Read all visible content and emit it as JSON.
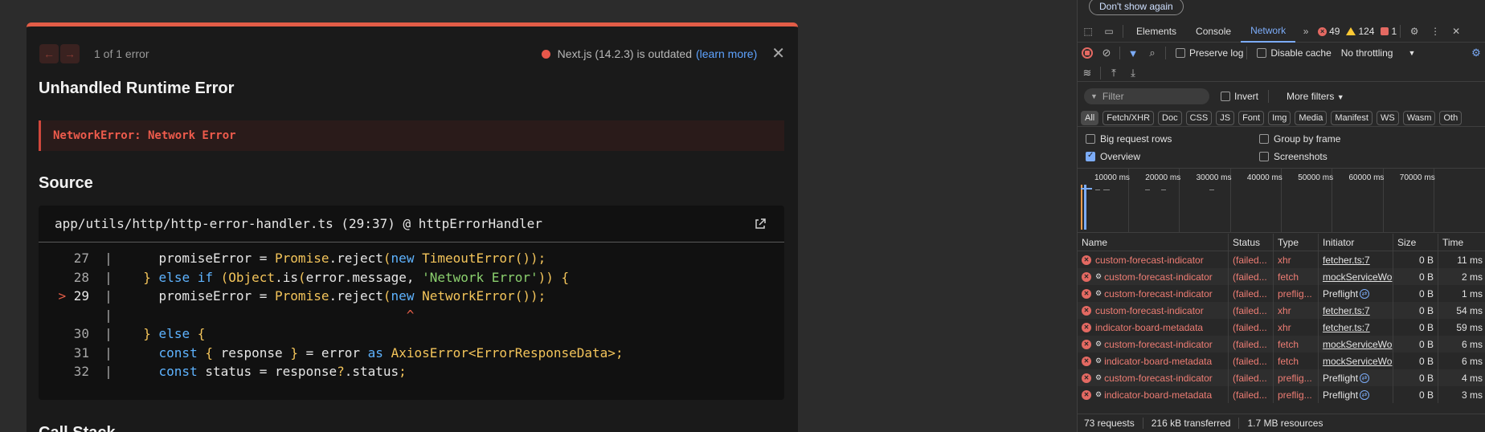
{
  "overlay": {
    "error_count": "1 of 1 error",
    "outdated_text": "Next.js (14.2.3) is outdated",
    "learn_more": "(learn more)",
    "title": "Unhandled Runtime Error",
    "error_message": "NetworkError: Network Error",
    "source_heading": "Source",
    "source_file": "app/utils/http/http-error-handler.ts (29:37) @ httpErrorHandler",
    "code_lines": [
      {
        "num": "27",
        "marker": "",
        "text": "    promiseError = Promise.reject(new TimeoutError());"
      },
      {
        "num": "28",
        "marker": "",
        "text": "  } else if (Object.is(error.message, 'Network Error')) {"
      },
      {
        "num": "29",
        "marker": ">",
        "text": "    promiseError = Promise.reject(new NetworkError());"
      },
      {
        "num": "",
        "marker": "",
        "text": "                                    ^"
      },
      {
        "num": "30",
        "marker": "",
        "text": "  } else {"
      },
      {
        "num": "31",
        "marker": "",
        "text": "    const { response } = error as AxiosError<ErrorResponseData>;"
      },
      {
        "num": "32",
        "marker": "",
        "text": "    const status = response?.status;"
      }
    ],
    "callstack_heading": "Call Stack",
    "colors": {
      "accent": "#e35d47",
      "link": "#5ea3ff",
      "keyword": "#5eb3ff",
      "type": "#f3c45a",
      "string": "#8bd06e"
    }
  },
  "devtools": {
    "dont_show_again": "Don't show again",
    "tabs": [
      "Elements",
      "Console",
      "Network"
    ],
    "active_tab": "Network",
    "error_badge": "49",
    "warning_badge": "124",
    "issue_badge": "1",
    "preserve_log": "Preserve log",
    "disable_cache": "Disable cache",
    "throttling": "No throttling",
    "filter_placeholder": "Filter",
    "invert": "Invert",
    "more_filters": "More filters",
    "type_filters": [
      "All",
      "Fetch/XHR",
      "Doc",
      "CSS",
      "JS",
      "Font",
      "Img",
      "Media",
      "Manifest",
      "WS",
      "Wasm",
      "Oth"
    ],
    "options": {
      "big_request_rows": "Big request rows",
      "group_by_frame": "Group by frame",
      "overview": "Overview",
      "screenshots": "Screenshots"
    },
    "timeline_ticks": [
      "10000 ms",
      "20000 ms",
      "30000 ms",
      "40000 ms",
      "50000 ms",
      "60000 ms",
      "70000 ms"
    ],
    "columns": [
      "Name",
      "Status",
      "Type",
      "Initiator",
      "Size",
      "Time"
    ],
    "requests": [
      {
        "name": "custom-forecast-indicator",
        "gear": false,
        "status": "(failed...",
        "type": "xhr",
        "initiator": "fetcher.ts:7",
        "init_link": true,
        "preflight": false,
        "size": "0 B",
        "time": "11 ms"
      },
      {
        "name": "custom-forecast-indicator",
        "gear": true,
        "status": "(failed...",
        "type": "fetch",
        "initiator": "mockServiceWo",
        "init_link": true,
        "preflight": false,
        "size": "0 B",
        "time": "2 ms"
      },
      {
        "name": "custom-forecast-indicator",
        "gear": true,
        "status": "(failed...",
        "type": "preflig...",
        "initiator": "Preflight",
        "init_link": false,
        "preflight": true,
        "size": "0 B",
        "time": "1 ms"
      },
      {
        "name": "custom-forecast-indicator",
        "gear": false,
        "status": "(failed...",
        "type": "xhr",
        "initiator": "fetcher.ts:7",
        "init_link": true,
        "preflight": false,
        "size": "0 B",
        "time": "54 ms"
      },
      {
        "name": "indicator-board-metadata",
        "gear": false,
        "status": "(failed...",
        "type": "xhr",
        "initiator": "fetcher.ts:7",
        "init_link": true,
        "preflight": false,
        "size": "0 B",
        "time": "59 ms"
      },
      {
        "name": "custom-forecast-indicator",
        "gear": true,
        "status": "(failed...",
        "type": "fetch",
        "initiator": "mockServiceWo",
        "init_link": true,
        "preflight": false,
        "size": "0 B",
        "time": "6 ms"
      },
      {
        "name": "indicator-board-metadata",
        "gear": true,
        "status": "(failed...",
        "type": "fetch",
        "initiator": "mockServiceWo",
        "init_link": true,
        "preflight": false,
        "size": "0 B",
        "time": "6 ms"
      },
      {
        "name": "custom-forecast-indicator",
        "gear": true,
        "status": "(failed...",
        "type": "preflig...",
        "initiator": "Preflight",
        "init_link": false,
        "preflight": true,
        "size": "0 B",
        "time": "4 ms"
      },
      {
        "name": "indicator-board-metadata",
        "gear": true,
        "status": "(failed...",
        "type": "preflig...",
        "initiator": "Preflight",
        "init_link": false,
        "preflight": true,
        "size": "0 B",
        "time": "3 ms"
      }
    ],
    "status_bar": {
      "requests": "73 requests",
      "transferred": "216 kB transferred",
      "resources": "1.7 MB resources"
    }
  }
}
